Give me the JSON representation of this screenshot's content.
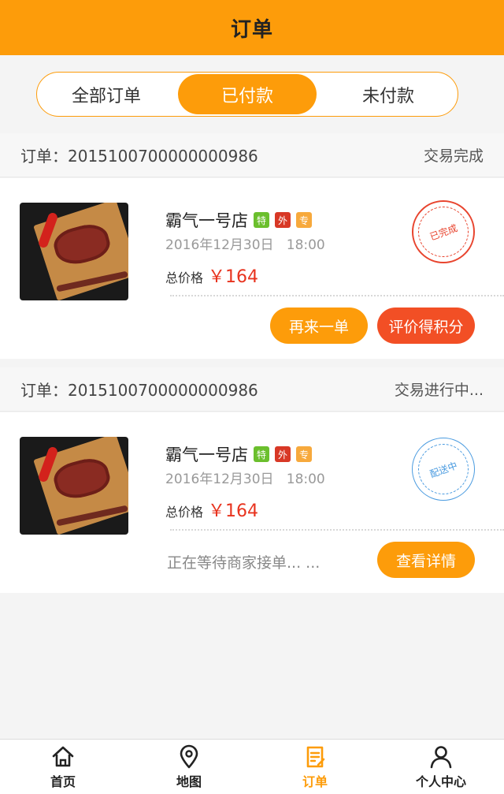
{
  "header": {
    "title": "订单"
  },
  "segment": {
    "tabs": [
      "全部订单",
      "已付款",
      "未付款"
    ],
    "active_index": 1
  },
  "orders": [
    {
      "order_label": "订单：",
      "order_no": "2015100700000000986",
      "status_text": "交易完成",
      "shop": "霸气一号店",
      "badges": [
        "特",
        "外",
        "专"
      ],
      "date": "2016年12月30日",
      "time": "18:00",
      "price_label": "总价格",
      "price": "￥164",
      "stamp": "已完成",
      "buttons": [
        "再来一单",
        "评价得积分"
      ]
    },
    {
      "order_label": "订单：",
      "order_no": "2015100700000000986",
      "status_text": "交易进行中...",
      "shop": "霸气一号店",
      "badges": [
        "特",
        "外",
        "专"
      ],
      "date": "2016年12月30日",
      "time": "18:00",
      "price_label": "总价格",
      "price": "￥164",
      "stamp": "配送中",
      "waiting_text": "正在等待商家接单... ...",
      "buttons": [
        "查看详情"
      ]
    }
  ],
  "tabbar": {
    "items": [
      {
        "label": "首页",
        "icon": "home-icon"
      },
      {
        "label": "地图",
        "icon": "map-pin-icon"
      },
      {
        "label": "订单",
        "icon": "order-doc-icon"
      },
      {
        "label": "个人中心",
        "icon": "user-icon"
      }
    ],
    "active_index": 2
  },
  "colors": {
    "accent": "#fd9c0a",
    "price": "#e8331e",
    "button_red": "#f24f25",
    "stamp_blue": "#4a9be0"
  }
}
